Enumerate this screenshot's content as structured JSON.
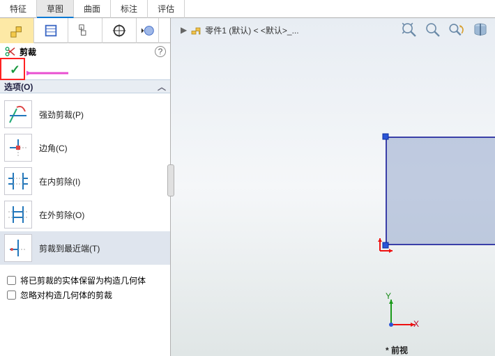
{
  "tabs": {
    "t0": "特征",
    "t1": "草图",
    "t2": "曲面",
    "t3": "标注",
    "t4": "评估"
  },
  "header": {
    "title": "剪裁"
  },
  "section": {
    "options": "选项(O)"
  },
  "opts": {
    "o0": "强劲剪裁(P)",
    "o1": "边角(C)",
    "o2": "在内剪除(I)",
    "o3": "在外剪除(O)",
    "o4": "剪裁到最近端(T)"
  },
  "checks": {
    "c0": "将已剪裁的实体保留为构造几何体",
    "c1": "忽略对构造几何体的剪裁"
  },
  "crumb": {
    "text": "零件1 (默认) < <默认>_..."
  },
  "axes": {
    "x": "X",
    "y": "Y"
  },
  "bot": "* 前视"
}
